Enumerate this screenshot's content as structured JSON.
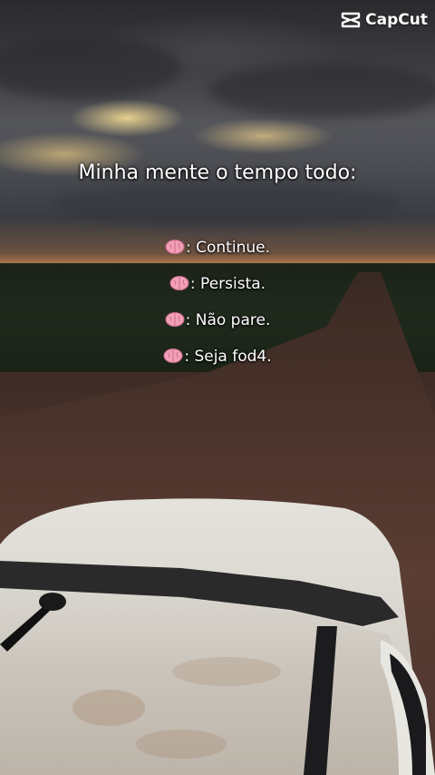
{
  "watermark": {
    "label": "CapCut",
    "icon": "capcut-logo-icon"
  },
  "headline": "Minha mente o tempo todo:",
  "lines": [
    {
      "icon": "brain-emoji-icon",
      "text": ": Continue."
    },
    {
      "icon": "brain-emoji-icon",
      "text": ": Persista."
    },
    {
      "icon": "brain-emoji-icon",
      "text": ": Não pare."
    },
    {
      "icon": "brain-emoji-icon",
      "text": ": Seja fod4."
    }
  ],
  "colors": {
    "text": "#ffffff",
    "brain": "#f2a0b8"
  }
}
